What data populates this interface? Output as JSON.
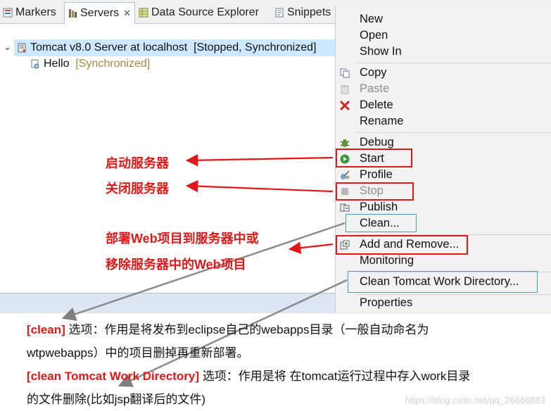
{
  "tabs": [
    {
      "label": "Markers",
      "icon": "markers-icon"
    },
    {
      "label": "Servers",
      "icon": "servers-icon",
      "active": true,
      "close": "✕"
    },
    {
      "label": "Data Source Explorer",
      "icon": "data-source-icon"
    },
    {
      "label": "Snippets",
      "icon": "snippets-icon"
    }
  ],
  "tree": {
    "server_label": "Tomcat v8.0 Server at localhost",
    "server_status": "[Stopped, Synchronized]",
    "module_label": "Hello",
    "module_status": "[Synchronized]"
  },
  "menu": {
    "new": "New",
    "open": "Open",
    "show_in": "Show In",
    "copy": "Copy",
    "paste": "Paste",
    "delete": "Delete",
    "rename": "Rename",
    "debug": "Debug",
    "start": "Start",
    "profile": "Profile",
    "stop": "Stop",
    "publish": "Publish",
    "clean": "Clean...",
    "add_remove": "Add and Remove...",
    "monitoring": "Monitoring",
    "clean_work_dir": "Clean Tomcat Work Directory...",
    "properties": "Properties"
  },
  "annotations": {
    "start_server": "启动服务器",
    "stop_server": "关闭服务器",
    "deploy_line1": "部署Web项目到服务器中或",
    "deploy_line2": "移除服务器中的Web项目"
  },
  "notes": {
    "clean_term": "[clean]",
    "clean_desc_1": " 选项：作用是将发布到eclipse自己的webapps目录（一般自动命名为",
    "clean_desc_2": "wtpwebapps）中的项目删掉再重新部署。",
    "clean_work_term": "[clean Tomcat Work Directory]",
    "clean_work_desc_1": " 选项：作用是将 在tomcat运行过程中存入work目录",
    "clean_work_desc_2": "的文件删除(比如jsp翻译后的文件)"
  },
  "watermark": "https://blog.csdn.net/qq_26866883",
  "colors": {
    "annotation_red": "#e01818",
    "highlight_blue": "#cde8ff",
    "status_olive": "#a08a3c"
  }
}
